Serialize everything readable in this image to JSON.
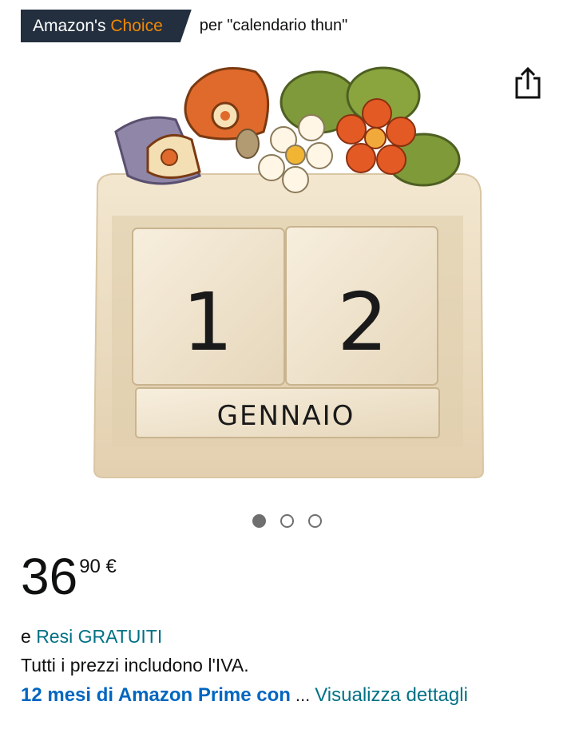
{
  "badge": {
    "prefix": "Amazon's ",
    "highlight": "Choice",
    "query": "per \"calendario thun\""
  },
  "share": {
    "icon": "share-icon"
  },
  "product_image": {
    "alt": "Calendario perpetuo Thun",
    "day_digit_1": "1",
    "day_digit_2": "2",
    "month": "GENNAIO"
  },
  "carousel": {
    "count": 3,
    "active_index": 0
  },
  "price": {
    "whole": "36",
    "fraction": "90 €"
  },
  "returns": {
    "prefix": "e",
    "link_label": "Resi GRATUITI"
  },
  "vat_note": "Tutti i prezzi includono l'IVA.",
  "prime": {
    "text": "12 mesi di Amazon Prime con",
    "ellipsis": "...",
    "details_link": "Visualizza dettagli"
  },
  "colors": {
    "badge_bg": "#232f3e",
    "badge_highlight": "#f08804",
    "link": "#007185",
    "prime": "#0066c0"
  }
}
